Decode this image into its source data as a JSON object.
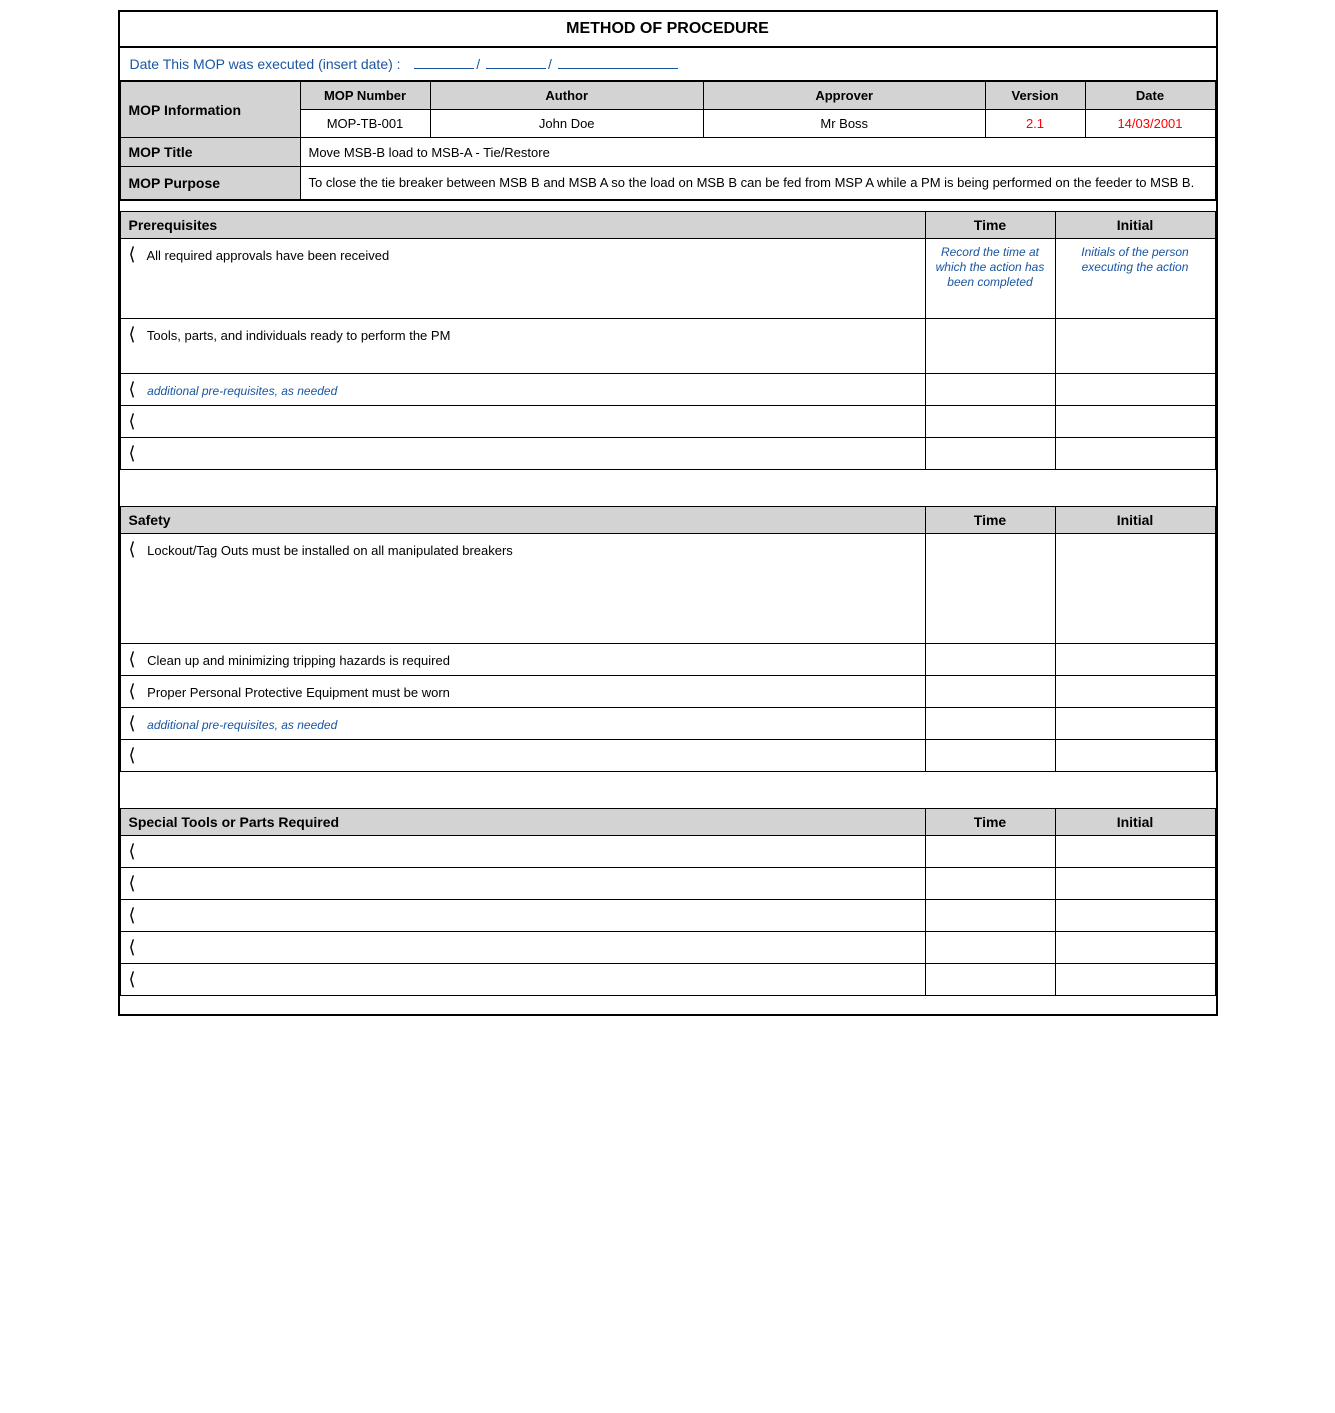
{
  "title": "METHOD OF PROCEDURE",
  "date_row": {
    "label": "Date This MOP was executed",
    "insert": "(insert date) :"
  },
  "mop_info": {
    "row1_headers": {
      "col1": "MOP Information",
      "col2": "MOP Number",
      "col3": "Author",
      "col4": "Approver",
      "col5": "Version",
      "col6": "Date"
    },
    "row2_data": {
      "col2": "MOP-TB-001",
      "col3": "John Doe",
      "col4": "Mr Boss",
      "col5": "2.1",
      "col6": "14/03/2001"
    }
  },
  "mop_title": {
    "label": "MOP Title",
    "value": "Move MSB-B load to MSB-A - Tie/Restore"
  },
  "mop_purpose": {
    "label": "MOP Purpose",
    "value": "To close the tie breaker between MSB B and MSB A so the load on MSB B can be fed from MSP A while a PM is being performed on the feeder to MSB B."
  },
  "prerequisites": {
    "header": "Prerequisites",
    "col_time": "Time",
    "col_initial": "Initial",
    "hint_time": "Record the time at which the action has been completed",
    "hint_initial": "Initials of the person executing the action",
    "rows": [
      {
        "text": "All required approvals have been received",
        "show_hint": true
      },
      {
        "text": "Tools, parts, and individuals ready to perform the PM",
        "show_hint": false
      },
      {
        "text": "additional pre-requisites, as needed",
        "italic": true,
        "show_hint": false
      },
      {
        "text": "",
        "show_hint": false
      },
      {
        "text": "",
        "show_hint": false
      }
    ]
  },
  "safety": {
    "header": "Safety",
    "col_time": "Time",
    "col_initial": "Initial",
    "rows": [
      {
        "text": "Lockout/Tag Outs must be installed on all manipulated breakers",
        "tall": true
      },
      {
        "text": "Clean up and minimizing tripping hazards is required",
        "tall": false
      },
      {
        "text": "Proper Personal Protective Equipment must be worn",
        "tall": false
      },
      {
        "text": "additional pre-requisites, as needed",
        "italic": true,
        "tall": false
      },
      {
        "text": "",
        "tall": false
      }
    ]
  },
  "special_tools": {
    "header": "Special Tools or Parts Required",
    "col_time": "Time",
    "col_initial": "Initial",
    "rows": [
      {
        "text": ""
      },
      {
        "text": ""
      },
      {
        "text": ""
      },
      {
        "text": ""
      },
      {
        "text": ""
      }
    ]
  }
}
